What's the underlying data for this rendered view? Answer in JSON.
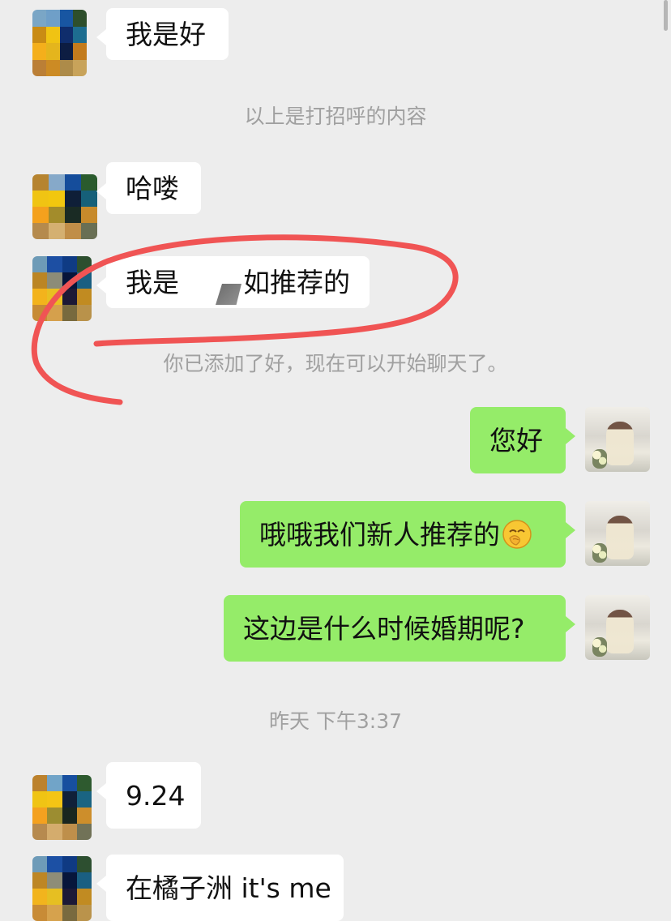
{
  "chat": {
    "messages": {
      "m1": "我是好",
      "system1": "以上是打招呼的内容",
      "m2": "哈喽",
      "m3_prefix": "我是",
      "m3_suffix": "如推荐的",
      "system2": "你已添加了好，现在可以开始聊天了。",
      "m4": "您好",
      "m5": "哦哦我们新人推荐的",
      "m6": "这边是什么时候婚期呢?",
      "timestamp": "昨天 下午3:37",
      "m7": "9.24",
      "m8": "在橘子洲 it's me"
    }
  },
  "icons": {
    "hand_over_mouth": "face-with-hand-over-mouth-icon"
  },
  "colors": {
    "background": "#ededed",
    "incoming_bubble": "#ffffff",
    "outgoing_bubble": "#95ec69",
    "system_text": "#a0a0a0",
    "annotation": "#f05454"
  }
}
